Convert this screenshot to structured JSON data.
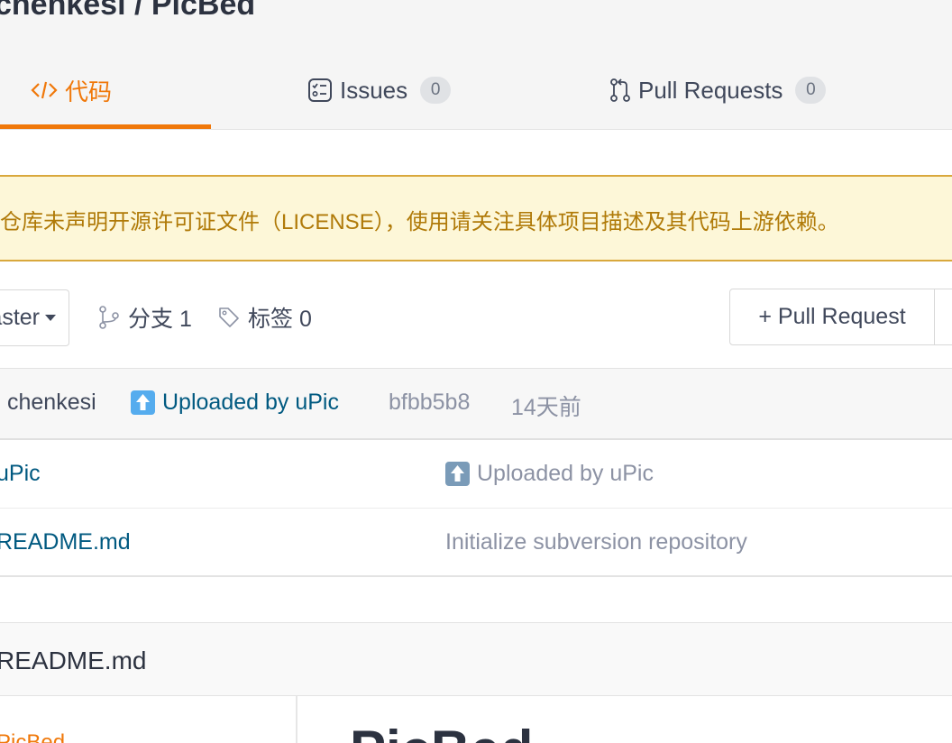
{
  "repo": {
    "title": "chenkesi / PicBed"
  },
  "tabs": [
    {
      "label": "代码",
      "active": true
    },
    {
      "label": "Issues",
      "count": "0"
    },
    {
      "label": "Pull Requests",
      "count": "0"
    }
  ],
  "license_banner": {
    "text": "仓库未声明开源许可证文件（LICENSE），使用请关注具体项目描述及其代码上游依赖。"
  },
  "toolbar": {
    "branch": "master",
    "branches_label": "分支 1",
    "tags_label": "标签 0",
    "pull_request_button": "+ Pull Request"
  },
  "latest_commit": {
    "author": "chenkesi",
    "message": "Uploaded by uPic",
    "hash": "bfbb5b8",
    "time": "14天前"
  },
  "files": [
    {
      "name": "uPic",
      "commit": "Uploaded by uPic",
      "commit_icon": "up-arrow-emoji"
    },
    {
      "name": "README.md",
      "commit": "Initialize subversion repository"
    }
  ],
  "readme": {
    "title": "README.md",
    "toc_link": "PicBed",
    "heading": "PicBed"
  },
  "colors": {
    "accent": "#f0780a",
    "link": "#005980",
    "banner_bg": "#fdf7d8",
    "banner_border": "#d9a83c",
    "banner_text": "#b07a08"
  }
}
